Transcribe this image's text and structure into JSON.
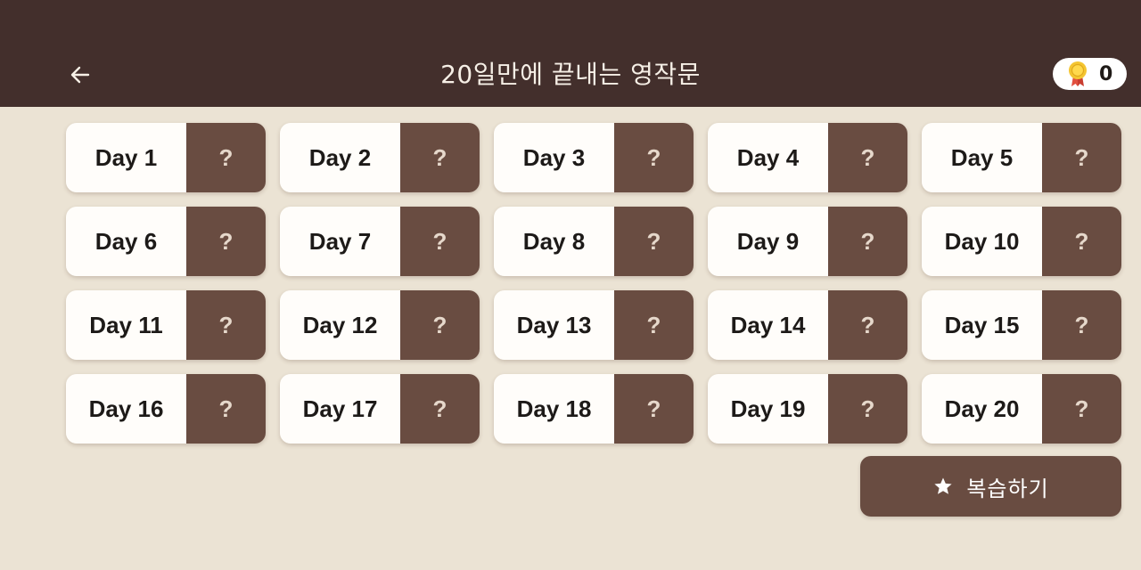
{
  "header": {
    "title": "20일만에 끝내는 영작문",
    "back_icon": "arrow-left-icon",
    "coin_icon": "medal-icon",
    "coin_count": "0",
    "background_color": "#432f2c"
  },
  "days": [
    {
      "label": "Day 1",
      "status": "?"
    },
    {
      "label": "Day 2",
      "status": "?"
    },
    {
      "label": "Day 3",
      "status": "?"
    },
    {
      "label": "Day 4",
      "status": "?"
    },
    {
      "label": "Day 5",
      "status": "?"
    },
    {
      "label": "Day 6",
      "status": "?"
    },
    {
      "label": "Day 7",
      "status": "?"
    },
    {
      "label": "Day 8",
      "status": "?"
    },
    {
      "label": "Day 9",
      "status": "?"
    },
    {
      "label": "Day 10",
      "status": "?"
    },
    {
      "label": "Day 11",
      "status": "?"
    },
    {
      "label": "Day 12",
      "status": "?"
    },
    {
      "label": "Day 13",
      "status": "?"
    },
    {
      "label": "Day 14",
      "status": "?"
    },
    {
      "label": "Day 15",
      "status": "?"
    },
    {
      "label": "Day 16",
      "status": "?"
    },
    {
      "label": "Day 17",
      "status": "?"
    },
    {
      "label": "Day 18",
      "status": "?"
    },
    {
      "label": "Day 19",
      "status": "?"
    },
    {
      "label": "Day 20",
      "status": "?"
    }
  ],
  "review_button": {
    "label": "복습하기",
    "icon": "star-icon"
  },
  "colors": {
    "page_background": "#ebe3d4",
    "card_background": "#fffdfa",
    "status_background": "#694c41",
    "accent": "#694c41"
  }
}
